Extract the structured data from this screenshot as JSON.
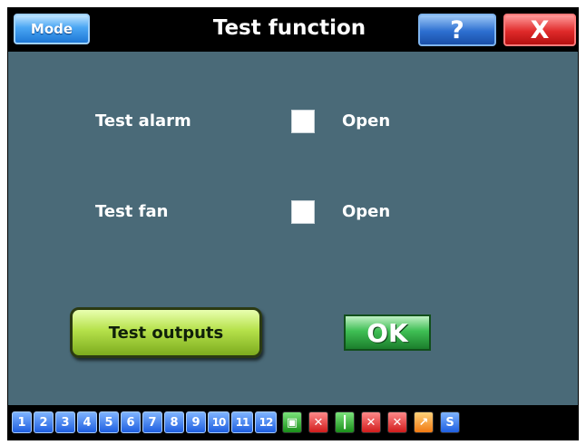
{
  "window": {
    "title": "Test function",
    "mode_label": "Mode",
    "help_label": "?",
    "close_label": "X"
  },
  "rows": [
    {
      "label": "Test alarm",
      "checked": false,
      "state": "Open"
    },
    {
      "label": "Test fan",
      "checked": false,
      "state": "Open"
    }
  ],
  "actions": {
    "test_outputs_label": "Test outputs",
    "ok_label": "OK"
  },
  "statusbar": {
    "numbers": [
      "1",
      "2",
      "3",
      "4",
      "5",
      "6",
      "7",
      "8",
      "9",
      "10",
      "11",
      "12"
    ],
    "icons": [
      {
        "name": "output-relay-icon",
        "glyph": "▣"
      },
      {
        "name": "fan-off-icon",
        "glyph": "✕"
      },
      {
        "name": "thermometer-icon",
        "glyph": "┃"
      },
      {
        "name": "alarm-off-icon",
        "glyph": "✕"
      },
      {
        "name": "chart-off-icon",
        "glyph": "✕"
      },
      {
        "name": "arrow-up-right-icon",
        "glyph": "↗"
      },
      {
        "name": "status-s-icon",
        "glyph": "S"
      }
    ]
  },
  "colors": {
    "panel_background": "#4a6a78",
    "title_bar": "#000000",
    "ok_green": "#3fbf54",
    "test_button_green": "#b5e14a"
  }
}
